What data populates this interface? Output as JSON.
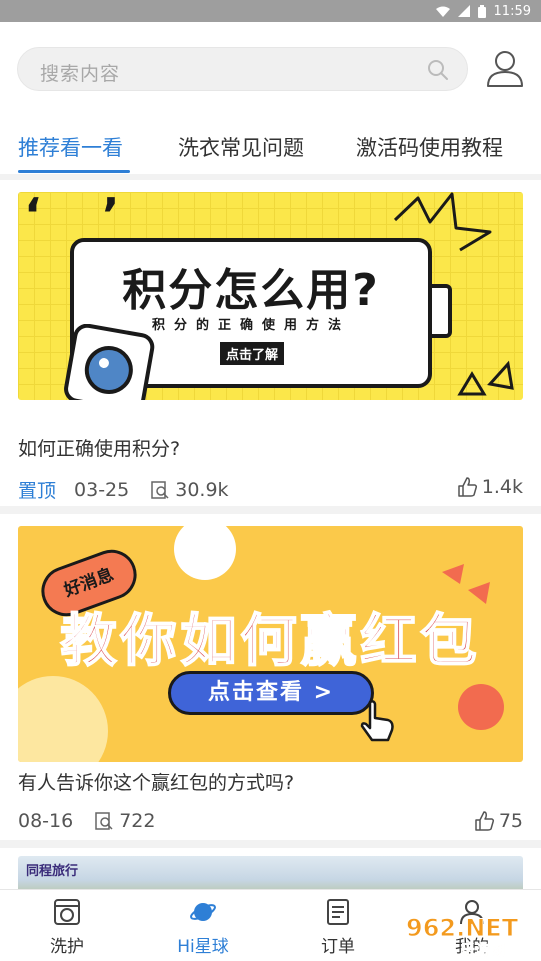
{
  "status_bar": {
    "time": "11:59"
  },
  "search": {
    "placeholder": "搜索内容"
  },
  "tabs": [
    {
      "label": "推荐看一看",
      "active": true
    },
    {
      "label": "洗衣常见问题",
      "active": false
    },
    {
      "label": "激活码使用教程",
      "active": false
    }
  ],
  "posts": [
    {
      "banner": {
        "title": "积分怎么用?",
        "subtitle": "积分的正确使用方法",
        "button": "点击了解"
      },
      "title": "如何正确使用积分?",
      "pinned_label": "置顶",
      "date": "03-25",
      "views": "30.9k",
      "likes": "1.4k"
    },
    {
      "banner": {
        "badge": "好消息",
        "headline": "教你如何赢红包",
        "button": "点击查看 >"
      },
      "title": "有人告诉你这个赢红包的方式吗?",
      "date": "08-16",
      "views": "722",
      "likes": "75"
    },
    {
      "banner": {
        "logo_text": "同程旅行"
      }
    }
  ],
  "bottom_nav": [
    {
      "label": "洗护",
      "icon": "washer-icon",
      "active": false
    },
    {
      "label": "Hi星球",
      "icon": "planet-icon",
      "active": true
    },
    {
      "label": "订单",
      "icon": "order-icon",
      "active": false
    },
    {
      "label": "我的",
      "icon": "profile-icon",
      "active": false
    }
  ],
  "watermark": {
    "text": "962.NET",
    "subtext": "乐游网"
  },
  "colors": {
    "accent": "#2e7fd6",
    "banner1_bg": "#fbe74a",
    "banner2_bg": "#fbc94a",
    "banner2_button": "#3f64d8",
    "headline_red": "#d8434a"
  }
}
